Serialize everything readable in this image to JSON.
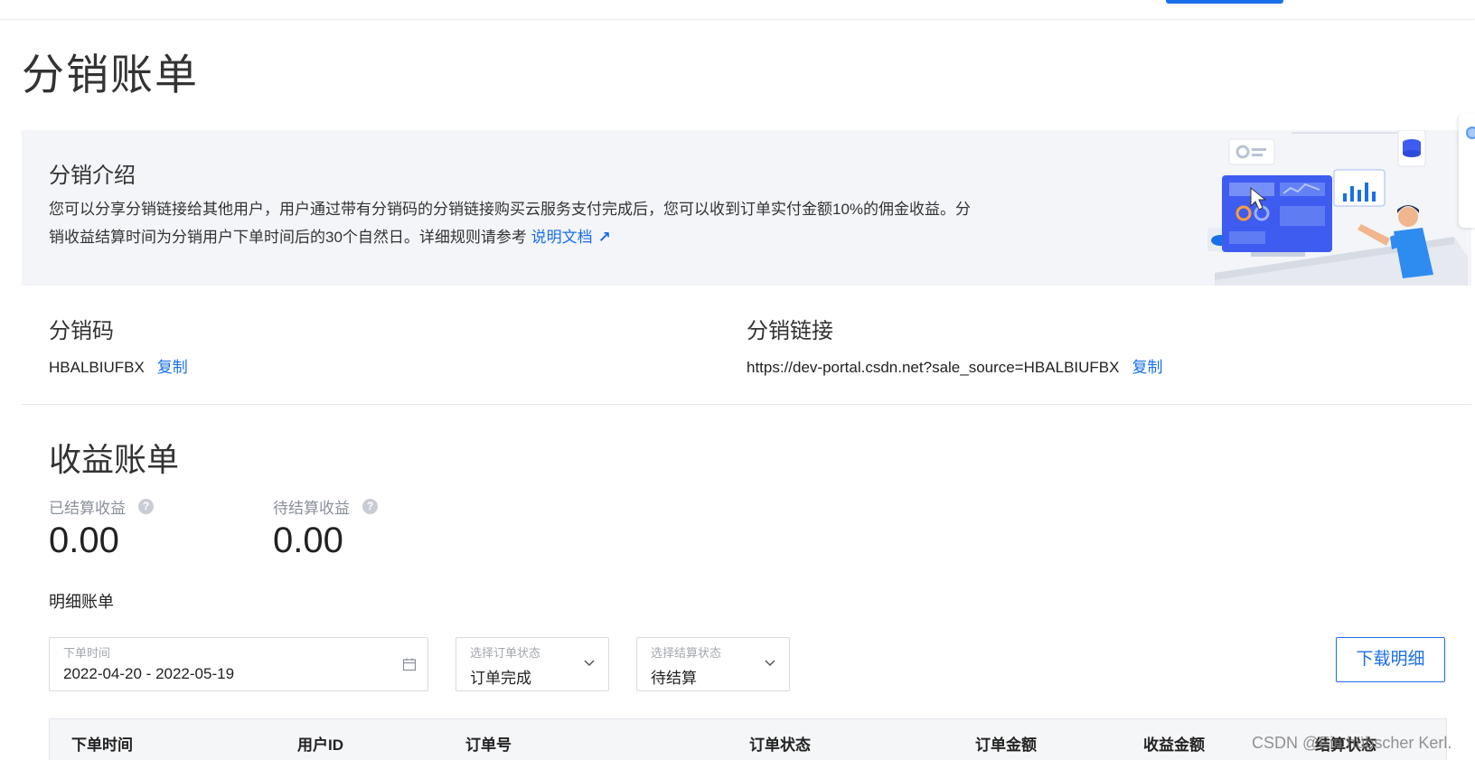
{
  "page": {
    "title": "分销账单"
  },
  "intro": {
    "heading": "分销介绍",
    "text": "您可以分享分销链接给其他用户，用户通过带有分销码的分销链接购买云服务支付完成后，您可以收到订单实付金额10%的佣金收益。分销收益结算时间为分销用户下单时间后的30个自然日。详细规则请参考",
    "doc_link": "说明文档"
  },
  "distribution": {
    "code_label": "分销码",
    "code_value": "HBALBIUFBX",
    "link_label": "分销链接",
    "link_value": "https://dev-portal.csdn.net?sale_source=HBALBIUFBX",
    "copy_label": "复制"
  },
  "earnings": {
    "title": "收益账单",
    "settled_label": "已结算收益",
    "settled_value": "0.00",
    "pending_label": "待结算收益",
    "pending_value": "0.00",
    "help_glyph": "?"
  },
  "details": {
    "title": "明细账单",
    "filters": [
      {
        "label": "下单时间",
        "value": "2022-04-20 - 2022-05-19"
      },
      {
        "label": "选择订单状态",
        "value": "订单完成"
      },
      {
        "label": "选择结算状态",
        "value": "待结算"
      }
    ],
    "download_label": "下载明细"
  },
  "table": {
    "columns": [
      "下单时间",
      "用户ID",
      "订单号",
      "订单状态",
      "订单金额",
      "收益金额",
      "结算状态"
    ]
  },
  "watermark": "CSDN @Ein hübscher Kerl.",
  "colors": {
    "accent": "#1a6fe8",
    "intro_bg": "#f3f5f9"
  }
}
